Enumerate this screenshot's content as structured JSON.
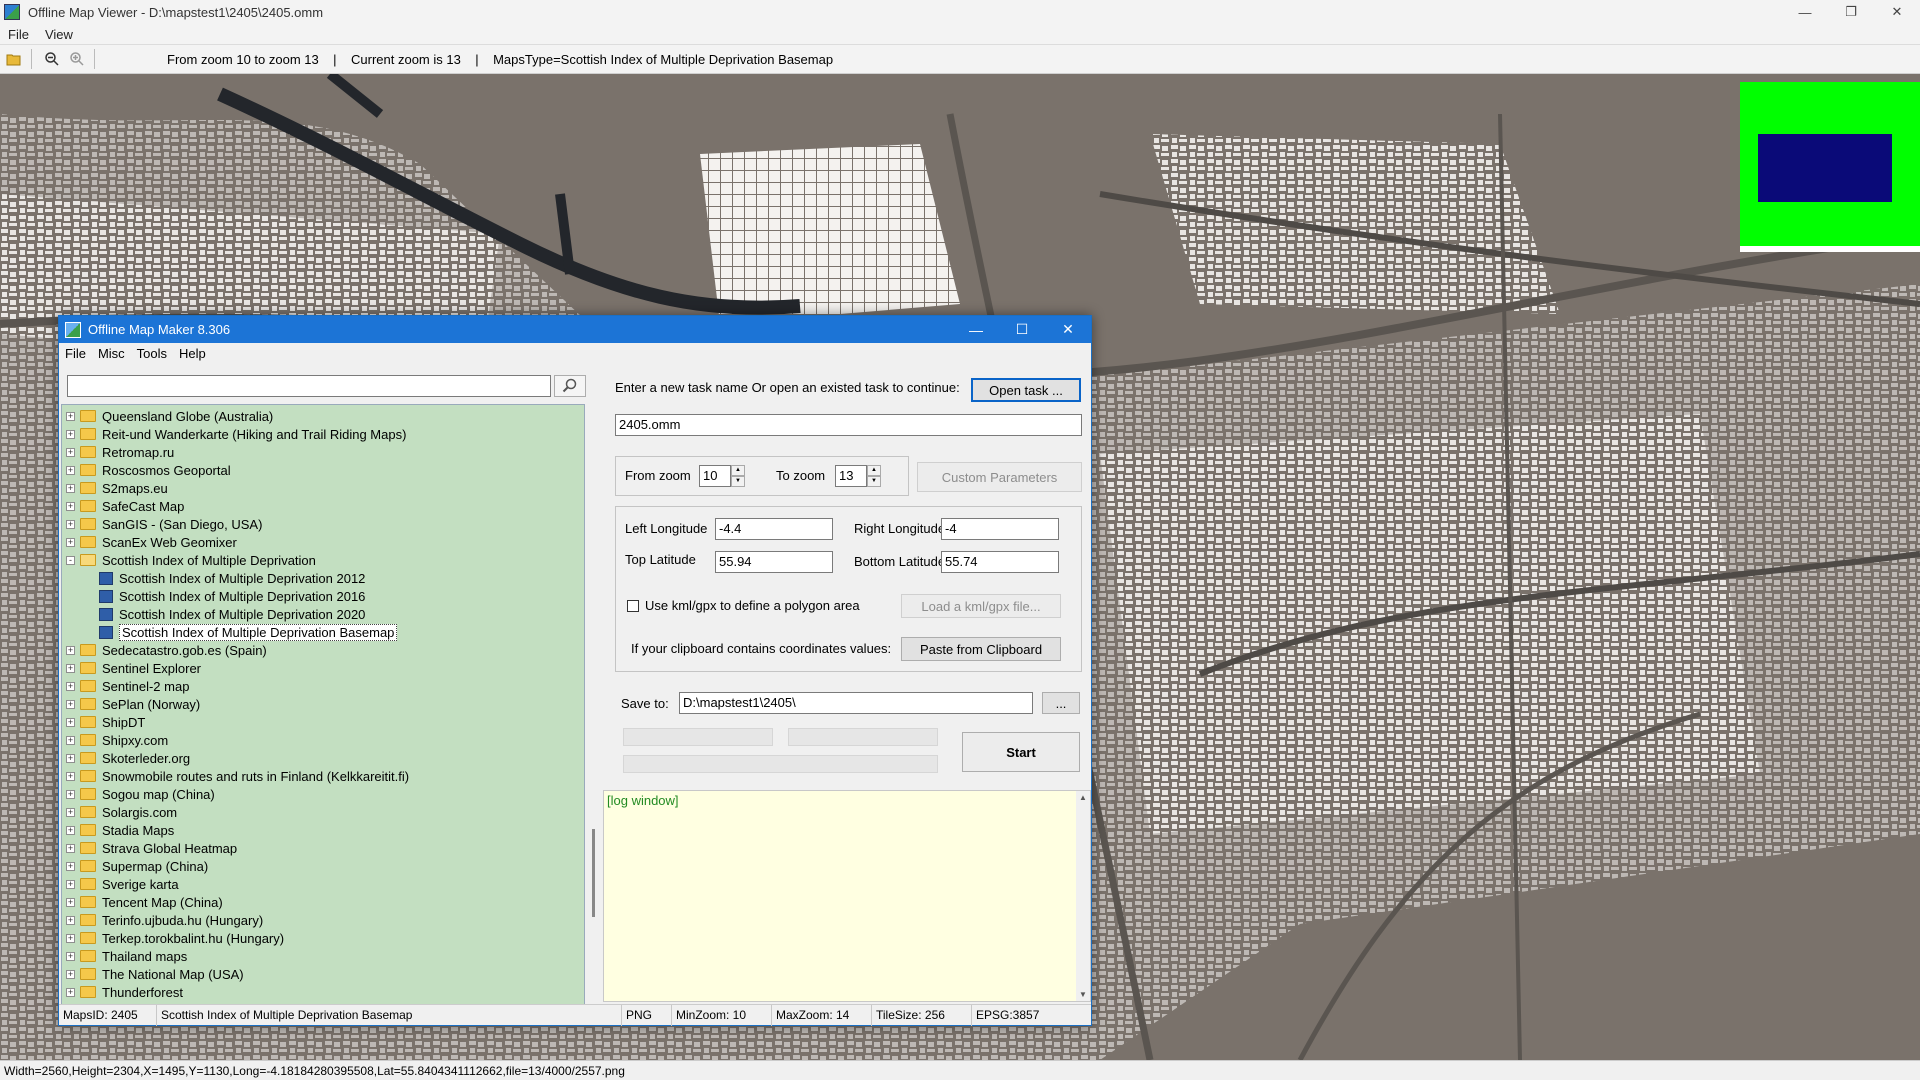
{
  "viewer": {
    "title": "Offline Map Viewer - D:\\mapstest1\\2405\\2405.omm",
    "menu": [
      "File",
      "View"
    ],
    "toolbar_info": "From zoom 10 to zoom 13    |    Current zoom is 13    |    MapsType=Scottish Index of Multiple Deprivation Basemap",
    "status": "Width=2560,Height=2304,X=1495,Y=1130,Long=-4.18184280395508,Lat=55.8404341112662,file=13/4000/2557.png"
  },
  "colors": {
    "map_bg": "#7a726b",
    "overview_bg": "#00ff00",
    "overview_box": "#0a0a78",
    "tree_bg": "#c3dfc1",
    "log_bg": "#ffffe1",
    "dialog_title": "#1c74d6"
  },
  "dialog": {
    "title": "Offline Map Maker 8.306",
    "menu": [
      "File",
      "Misc",
      "Tools",
      "Help"
    ],
    "search": {
      "value": ""
    },
    "tree": [
      {
        "label": "Queensland Globe (Australia)",
        "level": 0,
        "expander": "+"
      },
      {
        "label": "Reit-und Wanderkarte (Hiking and Trail Riding Maps)",
        "level": 0,
        "expander": "+"
      },
      {
        "label": "Retromap.ru",
        "level": 0,
        "expander": "+"
      },
      {
        "label": "Roscosmos Geoportal",
        "level": 0,
        "expander": "+"
      },
      {
        "label": "S2maps.eu",
        "level": 0,
        "expander": "+"
      },
      {
        "label": "SafeCast Map",
        "level": 0,
        "expander": "+"
      },
      {
        "label": "SanGIS - (San Diego, USA)",
        "level": 0,
        "expander": "+"
      },
      {
        "label": "ScanEx Web Geomixer",
        "level": 0,
        "expander": "+"
      },
      {
        "label": "Scottish Index of Multiple Deprivation",
        "level": 0,
        "expander": "-",
        "open": true
      },
      {
        "label": "Scottish Index of Multiple Deprivation 2012",
        "level": 1
      },
      {
        "label": "Scottish Index of Multiple Deprivation 2016",
        "level": 1
      },
      {
        "label": "Scottish Index of Multiple Deprivation 2020",
        "level": 1
      },
      {
        "label": "Scottish Index of Multiple Deprivation Basemap",
        "level": 1,
        "selected": true
      },
      {
        "label": "Sedecatastro.gob.es (Spain)",
        "level": 0,
        "expander": "+"
      },
      {
        "label": "Sentinel Explorer",
        "level": 0,
        "expander": "+"
      },
      {
        "label": "Sentinel-2 map",
        "level": 0,
        "expander": "+"
      },
      {
        "label": "SePlan (Norway)",
        "level": 0,
        "expander": "+"
      },
      {
        "label": "ShipDT",
        "level": 0,
        "expander": "+"
      },
      {
        "label": "Shipxy.com",
        "level": 0,
        "expander": "+"
      },
      {
        "label": "Skoterleder.org",
        "level": 0,
        "expander": "+"
      },
      {
        "label": "Snowmobile routes and ruts in Finland (Kelkkareitit.fi)",
        "level": 0,
        "expander": "+"
      },
      {
        "label": "Sogou map (China)",
        "level": 0,
        "expander": "+"
      },
      {
        "label": "Solargis.com",
        "level": 0,
        "expander": "+"
      },
      {
        "label": "Stadia Maps",
        "level": 0,
        "expander": "+"
      },
      {
        "label": "Strava Global Heatmap",
        "level": 0,
        "expander": "+"
      },
      {
        "label": "Supermap (China)",
        "level": 0,
        "expander": "+"
      },
      {
        "label": "Sverige karta",
        "level": 0,
        "expander": "+"
      },
      {
        "label": "Tencent Map (China)",
        "level": 0,
        "expander": "+"
      },
      {
        "label": "Terinfo.ujbuda.hu (Hungary)",
        "level": 0,
        "expander": "+"
      },
      {
        "label": "Terkep.torokbalint.hu (Hungary)",
        "level": 0,
        "expander": "+"
      },
      {
        "label": "Thailand maps",
        "level": 0,
        "expander": "+"
      },
      {
        "label": "The National Map (USA)",
        "level": 0,
        "expander": "+"
      },
      {
        "label": "Thunderforest",
        "level": 0,
        "expander": "+"
      }
    ],
    "task": {
      "prompt": "Enter a new task name Or open an existed task to continue:",
      "open_button": "Open task ...",
      "name": "2405.omm"
    },
    "zoom": {
      "from_label": "From zoom",
      "from_value": "10",
      "to_label": "To zoom",
      "to_value": "13",
      "custom_button": "Custom Parameters"
    },
    "coords": {
      "left_lon_label": "Left Longitude",
      "left_lon": "-4.4",
      "right_lon_label": "Right Longitude",
      "right_lon": "-4",
      "top_lat_label": "Top Latitude",
      "top_lat": "55.94",
      "bottom_lat_label": "Bottom Latitude",
      "bottom_lat": "55.74",
      "kml_label": "Use kml/gpx to define a polygon area",
      "kml_checked": false,
      "kml_button": "Load a kml/gpx file...",
      "clipboard_label": "If your clipboard contains coordinates values:",
      "clipboard_button": "Paste from Clipboard"
    },
    "save": {
      "label": "Save to:",
      "path": "D:\\mapstest1\\2405\\",
      "browse": "..."
    },
    "start_button": "Start",
    "log_text": "[log window]",
    "status": {
      "maps_id": "MapsID: 2405",
      "maps_name": "Scottish Index of Multiple Deprivation Basemap",
      "format": "PNG",
      "min_zoom": "MinZoom: 10",
      "max_zoom": "MaxZoom: 14",
      "tile_size": "TileSize: 256",
      "epsg": "EPSG:3857"
    }
  }
}
